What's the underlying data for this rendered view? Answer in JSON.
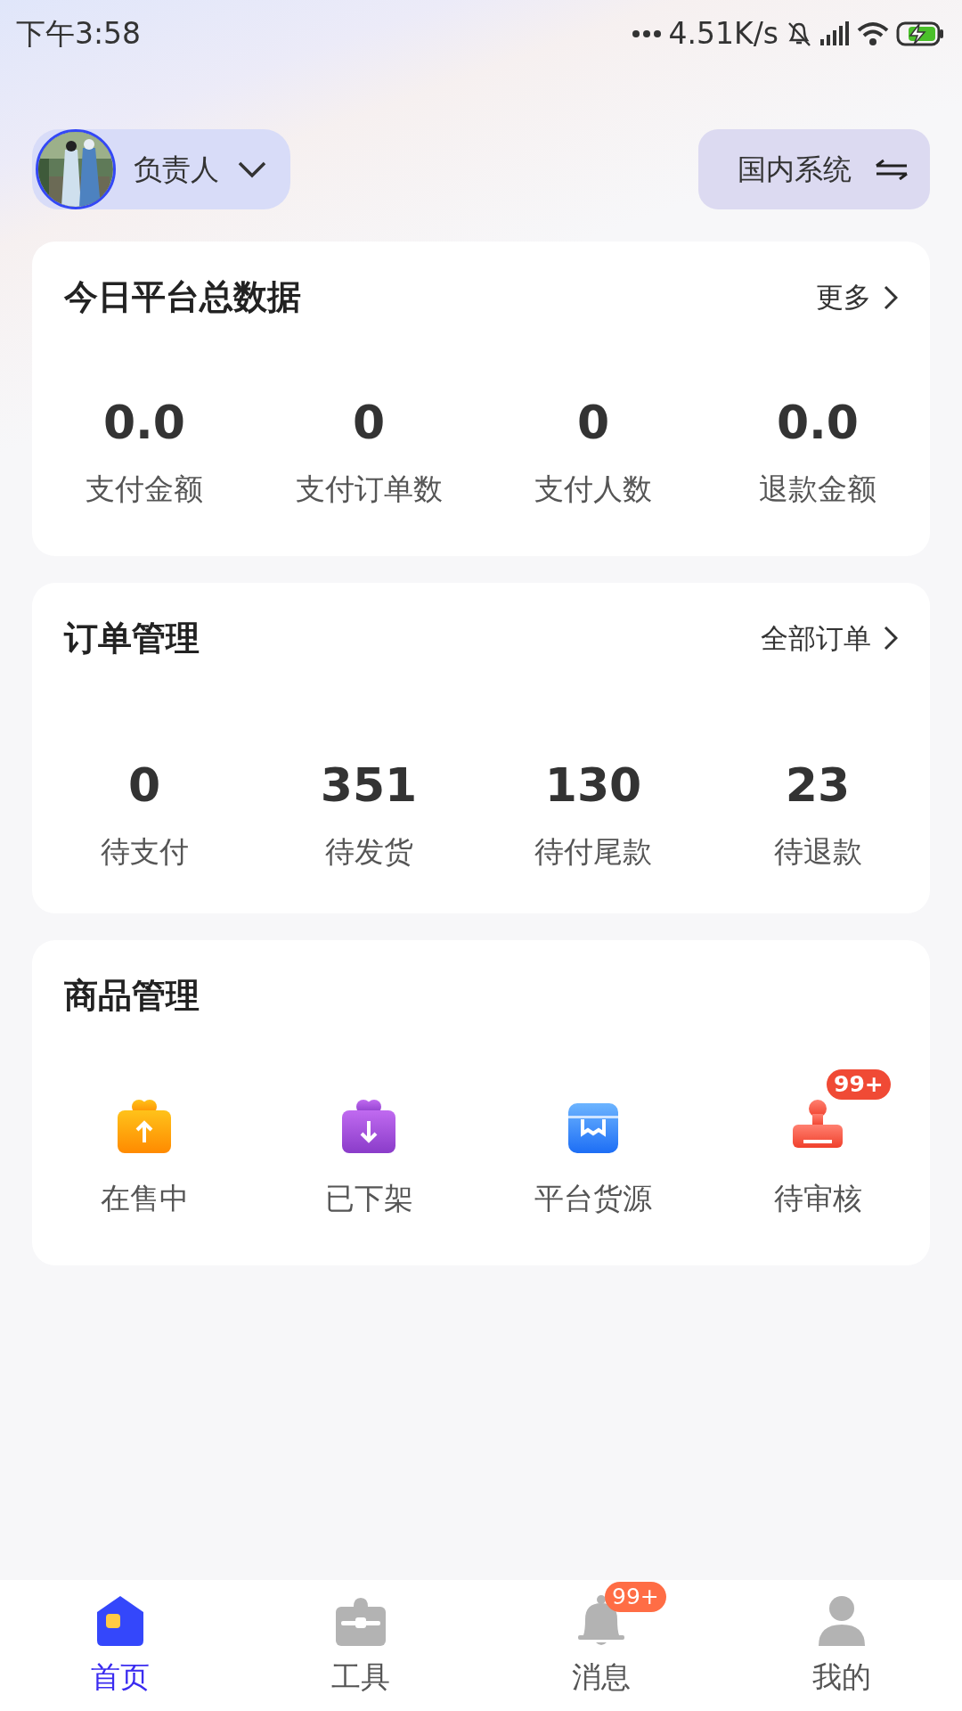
{
  "status_bar": {
    "time": "下午3:58",
    "net_speed": "4.51K/s"
  },
  "header": {
    "user_name": "负责人",
    "system": "国内系统"
  },
  "platform_stats": {
    "title": "今日平台总数据",
    "link": "更多",
    "items": [
      {
        "value": "0.0",
        "label": "支付金额"
      },
      {
        "value": "0",
        "label": "支付订单数"
      },
      {
        "value": "0",
        "label": "支付人数"
      },
      {
        "value": "0.0",
        "label": "退款金额"
      }
    ]
  },
  "order_management": {
    "title": "订单管理",
    "link": "全部订单",
    "items": [
      {
        "value": "0",
        "label": "待支付"
      },
      {
        "value": "351",
        "label": "待发货"
      },
      {
        "value": "130",
        "label": "待付尾款"
      },
      {
        "value": "23",
        "label": "待退款"
      }
    ]
  },
  "product_management": {
    "title": "商品管理",
    "items": [
      {
        "kind": "on-sale",
        "label": "在售中"
      },
      {
        "kind": "off-shelf",
        "label": "已下架"
      },
      {
        "kind": "source",
        "label": "平台货源"
      },
      {
        "kind": "review",
        "label": "待审核",
        "badge": "99+"
      }
    ]
  },
  "tab_bar": [
    {
      "kind": "home",
      "label": "首页",
      "selected": true
    },
    {
      "kind": "tools",
      "label": "工具",
      "selected": false
    },
    {
      "kind": "messages",
      "label": "消息",
      "selected": false,
      "badge": "99+"
    },
    {
      "kind": "me",
      "label": "我的",
      "selected": false
    }
  ]
}
